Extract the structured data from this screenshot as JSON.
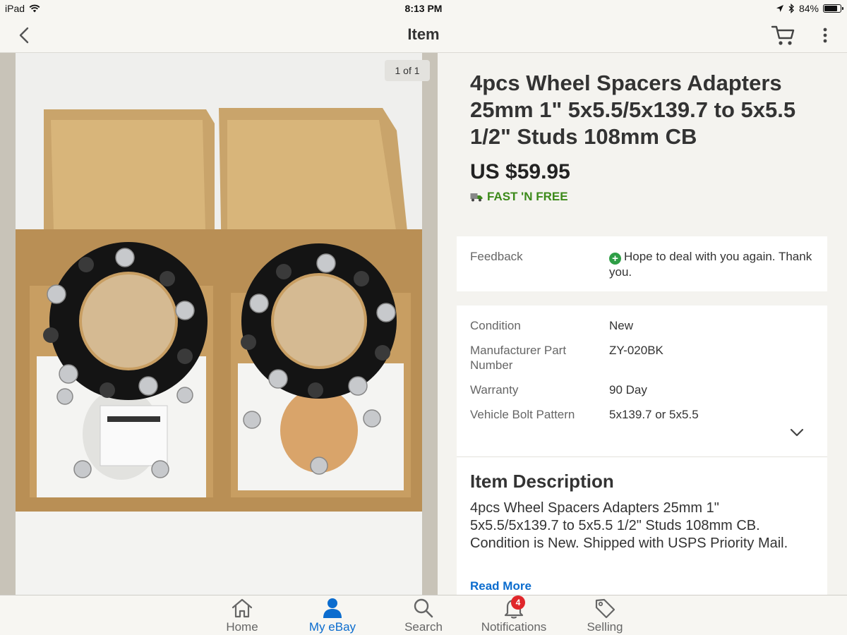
{
  "status_bar": {
    "device": "iPad",
    "time": "8:13 PM",
    "battery": "84%",
    "battery_level": 0.84
  },
  "nav": {
    "title": "Item"
  },
  "gallery": {
    "counter": "1 of 1"
  },
  "item": {
    "title": "4pcs Wheel Spacers Adapters 25mm 1\" 5x5.5/5x139.7 to 5x5.5 1/2\" Studs 108mm CB",
    "price": "US $59.95",
    "shipping": "FAST 'N FREE"
  },
  "feedback": {
    "label": "Feedback",
    "text": "Hope to deal with you again. Thank you."
  },
  "specifics": [
    {
      "key": "Condition",
      "value": "New"
    },
    {
      "key": "Manufacturer Part Number",
      "value": "ZY-020BK"
    },
    {
      "key": "Warranty",
      "value": "90 Day"
    },
    {
      "key": "Vehicle Bolt Pattern",
      "value": "5x139.7 or 5x5.5"
    }
  ],
  "description": {
    "heading": "Item Description",
    "text": "4pcs Wheel Spacers Adapters 25mm 1\" 5x5.5/5x139.7 to 5x5.5 1/2\" Studs 108mm CB. Condition is New. Shipped with USPS Priority Mail.",
    "read_more": "Read More"
  },
  "tabs": [
    {
      "label": "Home",
      "icon": "home-icon"
    },
    {
      "label": "My eBay",
      "icon": "person-icon"
    },
    {
      "label": "Search",
      "icon": "search-icon"
    },
    {
      "label": "Notifications",
      "icon": "bell-icon",
      "badge": "4"
    },
    {
      "label": "Selling",
      "icon": "tag-icon"
    }
  ],
  "colors": {
    "accent": "#0b6cce",
    "shipping_green": "#3c8a1a",
    "badge_red": "#e0262b"
  }
}
